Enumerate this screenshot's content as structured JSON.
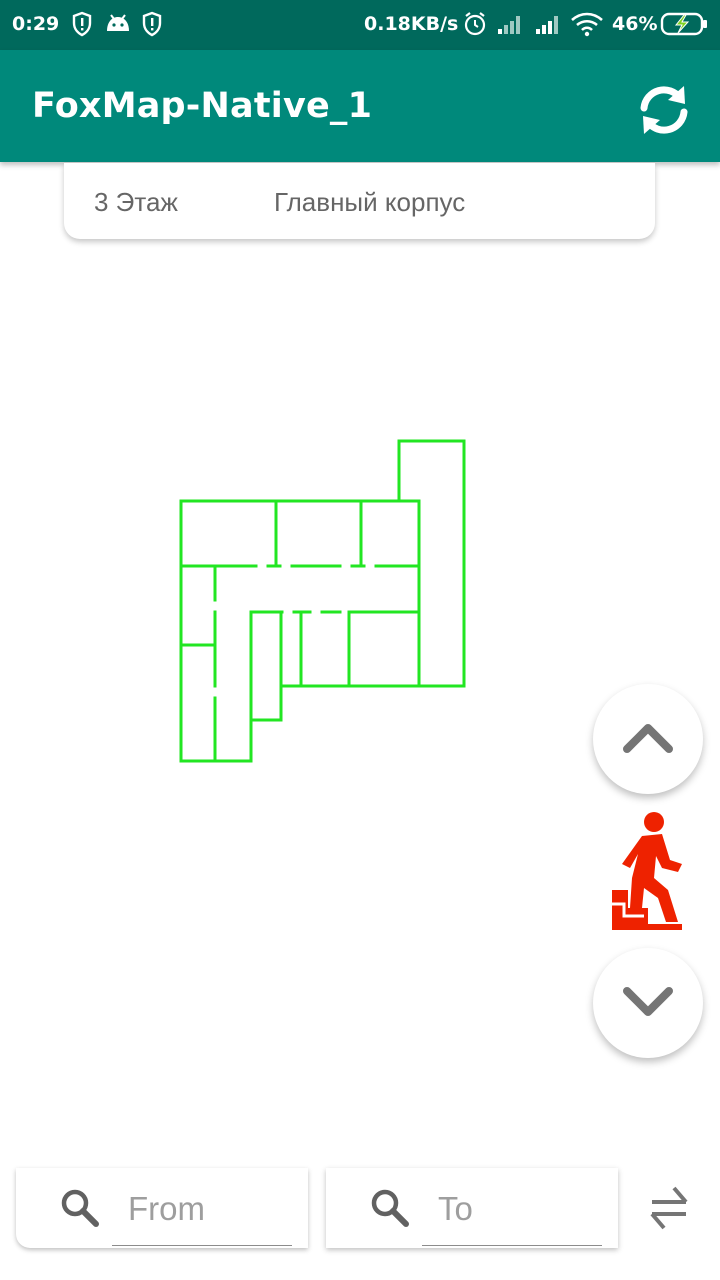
{
  "status_bar": {
    "time": "0:29",
    "network_speed": "0.18KB/s",
    "battery": "46%",
    "icons": [
      "shield-icon",
      "android-icon",
      "shield-icon",
      "alarm-icon",
      "signal-icon",
      "signal-icon",
      "wifi-icon",
      "battery-charging-icon"
    ]
  },
  "app_bar": {
    "title": "FoxMap-Native_1",
    "action_icon": "refresh-icon"
  },
  "location_card": {
    "floor": "3 Этаж",
    "building": "Главный корпус"
  },
  "map": {
    "line_color": "#22e622"
  },
  "floor_nav": {
    "up_icon": "chevron-up-icon",
    "down_icon": "chevron-down-icon",
    "stairs_icon": "stairs-person-icon",
    "stairs_color": "#ee2200"
  },
  "route": {
    "from_placeholder": "From",
    "to_placeholder": "To",
    "swap_icon": "swap-icon"
  },
  "colors": {
    "status_bar": "#00695c",
    "app_bar": "#00897b",
    "accent": "#00897b"
  }
}
